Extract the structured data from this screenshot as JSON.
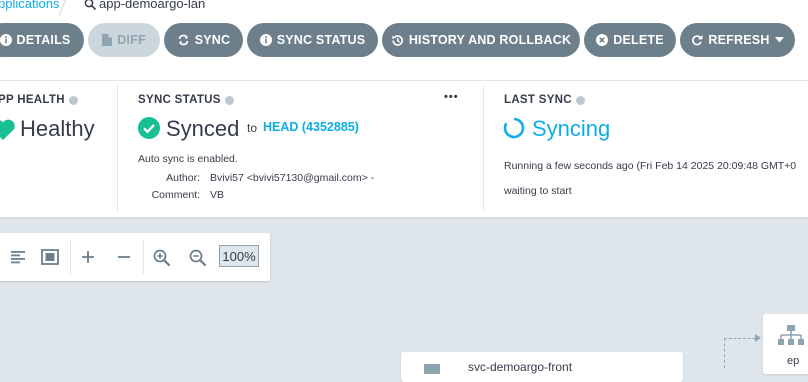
{
  "breadcrumb": {
    "apps_label": "pplications",
    "current_label": "app-demoargo-lan"
  },
  "toolbar": {
    "details": "DETAILS",
    "diff": "DIFF",
    "sync": "SYNC",
    "sync_status": "SYNC STATUS",
    "history": "HISTORY AND ROLLBACK",
    "delete": "DELETE",
    "refresh": "REFRESH"
  },
  "app_health": {
    "title": "PP HEALTH",
    "value": "Healthy"
  },
  "sync_status": {
    "title": "SYNC STATUS",
    "more": "•••",
    "value": "Synced",
    "to_text": "to",
    "revision": "HEAD (4352885)",
    "auto_sync": "Auto sync is enabled.",
    "author_label": "Author:",
    "author_value": "Bvivi57 <bvivi57130@gmail.com> -",
    "comment_label": "Comment:",
    "comment_value": "VB"
  },
  "last_sync": {
    "title": "LAST SYNC",
    "value": "Syncing",
    "running": "Running a few seconds ago (Fri Feb 14 2025 20:09:48 GMT+0",
    "waiting": "waiting to start"
  },
  "graph": {
    "zoom": "100%",
    "app_node_name": "svc-demoargo-front",
    "ep_node_label": "ep"
  },
  "colors": {
    "accent": "#0dadea",
    "healthy": "#18be94",
    "button": "#6d7f8b",
    "button_disabled": "#ccd6dd"
  }
}
